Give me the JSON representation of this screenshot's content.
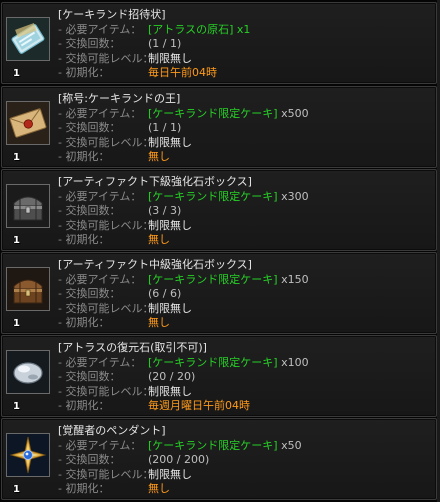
{
  "labels": {
    "required_item": "- 必要アイテム：",
    "exchange_count": "- 交換回数：",
    "exchange_level": "- 交換可能レベル：",
    "reset": "- 初期化："
  },
  "items": [
    {
      "name": "[ケーキランド招待状]",
      "icon": "ticket-icon",
      "quantity": "1",
      "required_item": "[アトラスの原石]",
      "required_qty": "x1",
      "count": "(1 / 1)",
      "level": "制限無し",
      "reset": "毎日午前04時"
    },
    {
      "name": "[称号:ケーキランドの王]",
      "icon": "sealed-letter-icon",
      "quantity": "1",
      "required_item": "[ケーキランド限定ケーキ]",
      "required_qty": "x500",
      "count": "(1 / 1)",
      "level": "制限無し",
      "reset": "無し"
    },
    {
      "name": "[アーティファクト下級強化石ボックス]",
      "icon": "treasure-chest-icon",
      "quantity": "1",
      "required_item": "[ケーキランド限定ケーキ]",
      "required_qty": "x300",
      "count": "(3 / 3)",
      "level": "制限無し",
      "reset": "無し"
    },
    {
      "name": "[アーティファクト中級強化石ボックス]",
      "icon": "treasure-chest-icon",
      "quantity": "1",
      "required_item": "[ケーキランド限定ケーキ]",
      "required_qty": "x150",
      "count": "(6 / 6)",
      "level": "制限無し",
      "reset": "無し"
    },
    {
      "name": "[アトラスの復元石(取引不可)]",
      "icon": "stone-icon",
      "quantity": "1",
      "required_item": "[ケーキランド限定ケーキ]",
      "required_qty": "x100",
      "count": "(20 / 20)",
      "level": "制限無し",
      "reset": "毎週月曜日午前04時"
    },
    {
      "name": "[覚醒者のペンダント]",
      "icon": "star-pendant-icon",
      "quantity": "1",
      "required_item": "[ケーキランド限定ケーキ]",
      "required_qty": "x50",
      "count": "(200 / 200)",
      "level": "制限無し",
      "reset": "無し"
    }
  ]
}
